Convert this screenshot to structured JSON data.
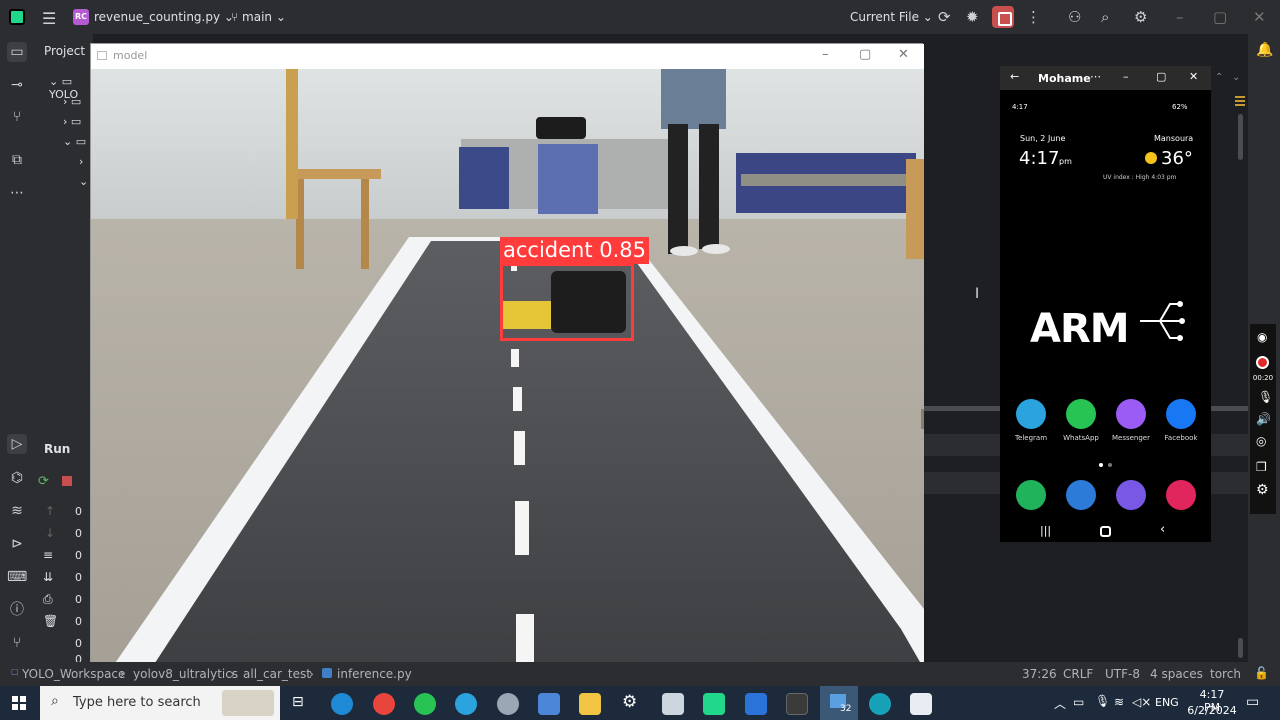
{
  "ide": {
    "project_badge": "RC",
    "file_name": "revenue_counting.py",
    "branch": "main",
    "current_file": "Current File",
    "project_label": "Project",
    "tree_root": "YOLO",
    "run_label": "Run",
    "run_output": [
      "0",
      "0",
      "0",
      "0",
      "0",
      "0",
      "0",
      "0",
      "0"
    ]
  },
  "status": {
    "breadcrumb": [
      "YOLO_Workspace",
      "yolov8_ultralytics",
      "all_car_test",
      "inference.py"
    ],
    "position": "37:26",
    "line_sep": "CRLF",
    "encoding": "UTF-8",
    "indent": "4 spaces",
    "interpreter": "torch"
  },
  "model_window": {
    "title": "model",
    "detection_label": "accident 0.85"
  },
  "phone": {
    "title": "Mohame",
    "status_time": "4:17",
    "battery": "62%",
    "date": "Sun, 2 June",
    "location": "Mansoura",
    "clock": "4:17",
    "ampm": "pm",
    "temp": "36°",
    "uv": "UV index : High   4:03 pm",
    "logo": "ARM",
    "apps": [
      "Telegram",
      "WhatsApp",
      "Messenger",
      "Facebook"
    ]
  },
  "taskbar": {
    "search_placeholder": "Type here to search",
    "badge": "32",
    "lang": "ENG",
    "time": "4:17 PM",
    "date": "6/2/2024"
  },
  "recorder": {
    "timer": "00:20"
  },
  "colors": {
    "ide_bg": "#1e1f22",
    "panel_bg": "#2b2d30",
    "detection": "#ff3b3b",
    "taskbar": "#1c2a3b"
  }
}
